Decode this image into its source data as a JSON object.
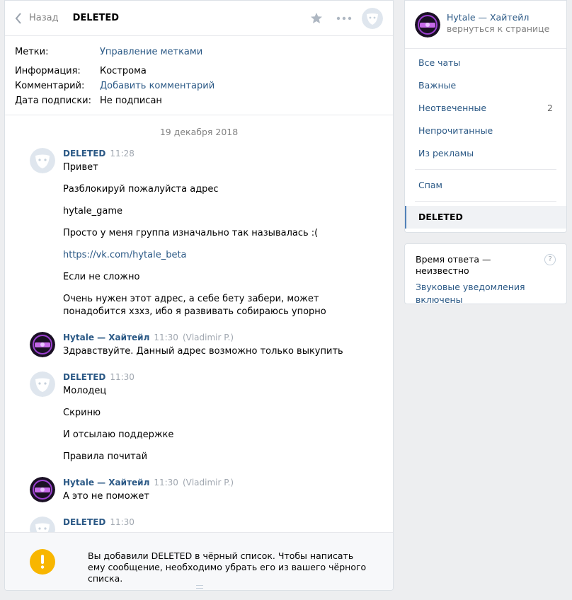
{
  "header": {
    "back_label": "Назад",
    "title": "DELETED"
  },
  "info": {
    "rows": [
      {
        "label": "Метки:",
        "value": "Управление метками",
        "is_link": true
      },
      {
        "label": "Информация:",
        "value": "Кострома",
        "is_link": false
      },
      {
        "label": "Комментарий:",
        "value": "Добавить комментарий",
        "is_link": true
      },
      {
        "label": "Дата подписки:",
        "value": "Не подписан",
        "is_link": false
      }
    ]
  },
  "date_separator": "19 декабря 2018",
  "messages": [
    {
      "author": "DELETED",
      "time": "11:28",
      "extra": "",
      "lines": [
        "Привет",
        "Разблокируй пожалуйста адрес",
        "hytale_game",
        "Просто у меня группа изначально так называлась :(",
        "https://vk.com/hytale_beta",
        "Если не сложно",
        "Очень нужен этот адрес, а себе бету забери, может понадобится хзхз, ибо я развивать собираюсь упорно"
      ]
    },
    {
      "author": "Hytale — Хайтейл",
      "time": "11:30",
      "extra": "(Vladimir P.)",
      "lines": [
        "Здравствуйте. Данный адрес возможно только выкупить"
      ]
    },
    {
      "author": "DELETED",
      "time": "11:30",
      "extra": "",
      "lines": [
        "Молодец",
        "Скриню",
        "И отсылаю поддержке",
        "Правила почитай"
      ]
    },
    {
      "author": "Hytale — Хайтейл",
      "time": "11:30",
      "extra": "(Vladimir P.)",
      "lines": [
        "А это не поможет"
      ]
    },
    {
      "author": "DELETED",
      "time": "11:30",
      "extra": "",
      "lines": []
    }
  ],
  "banner": {
    "text": "Вы добавили DELETED в чёрный список. Чтобы написать ему сообщение, необходимо убрать его из вашего чёрного списка."
  },
  "sidebar": {
    "group_name": "Hytale — Хайтейл",
    "group_back": "вернуться к странице",
    "items": [
      {
        "label": "Все чаты",
        "count": ""
      },
      {
        "label": "Важные",
        "count": ""
      },
      {
        "label": "Неотвеченные",
        "count": "2"
      },
      {
        "label": "Непрочитанные",
        "count": ""
      },
      {
        "label": "Из рекламы",
        "count": ""
      }
    ],
    "spam": "Спам",
    "active": "DELETED"
  },
  "response": {
    "text": "Время ответа — неизвестно",
    "help": "?",
    "sound": "Звуковые уведомления включены"
  },
  "colors": {
    "link": "#2a5885",
    "muted": "#828282",
    "warning": "#f8b600",
    "page_bg": "#edeef0"
  }
}
